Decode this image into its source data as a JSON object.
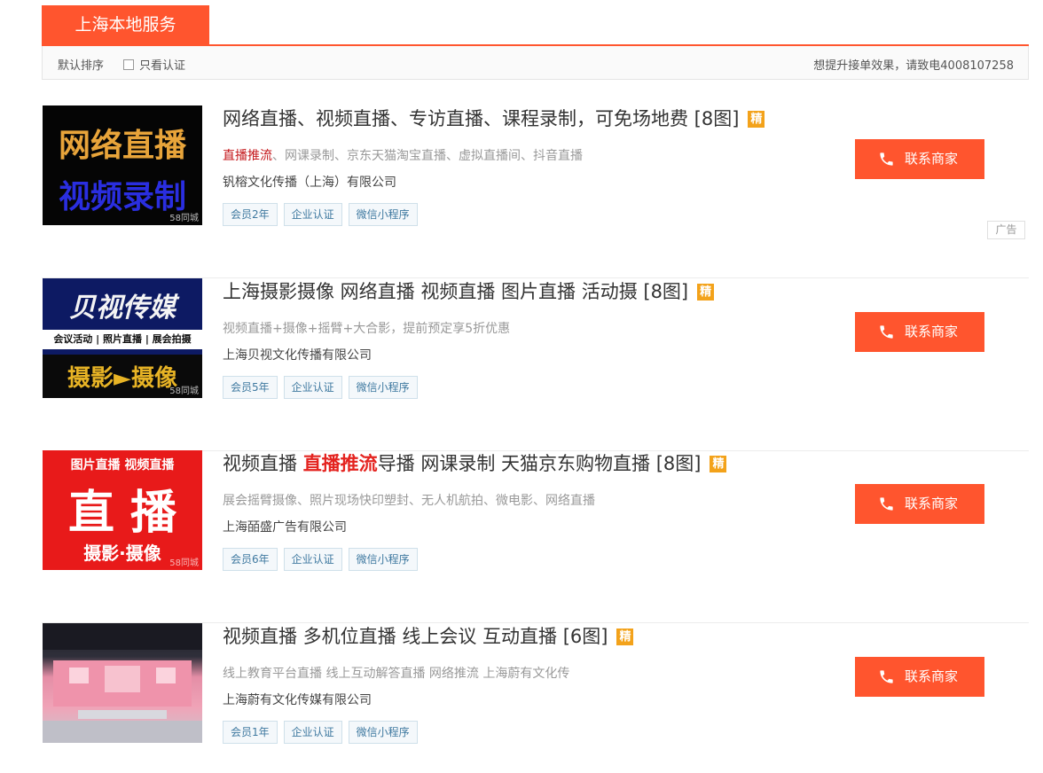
{
  "tab": {
    "label": "上海本地服务"
  },
  "filter": {
    "sort_default": "默认排序",
    "verified_only": "只看认证",
    "upgrade_tip": "想提升接单效果，请致电4008107258"
  },
  "ad_label": "广告",
  "contact_label": "联系商家",
  "jing_label": "精",
  "colors": {
    "accent": "#ff552e",
    "badge_text": "#3f79a0",
    "jing": "#f3a21a",
    "highlight": "#e4231f"
  },
  "listings": [
    {
      "title": "网络直播、视频直播、专访直播、课程录制，可免场地费 [8图]",
      "desc_highlight": "直播推流",
      "desc_rest": "、网课录制、京东天猫淘宝直播、虚拟直播间、抖音直播",
      "company": "钒榕文化传播（上海）有限公司",
      "badges": [
        "会员2年",
        "企业认证",
        "微信小程序"
      ],
      "thumb": {
        "line1": "网络直播",
        "line2": "视频录制",
        "watermark": "58同城"
      }
    },
    {
      "title": "上海摄影摄像 网络直播 视频直播 图片直播 活动摄 [8图]",
      "desc": "视频直播+摄像+摇臂+大合影，提前预定享5折优惠",
      "company": "上海贝视文化传播有限公司",
      "badges": [
        "会员5年",
        "企业认证",
        "微信小程序"
      ],
      "thumb": {
        "line1": "贝视传媒",
        "line2": "会议活动 | 照片直播 | 展会拍摄",
        "line3": "摄影►摄像",
        "watermark": "58同城"
      }
    },
    {
      "title_pre": "视频直播 ",
      "title_hl": "直播推流",
      "title_post": "导播 网课录制 天猫京东购物直播 [8图]",
      "desc": "展会摇臂摄像、照片现场快印塑封、无人机航拍、微电影、网络直播",
      "company": "上海皕盛广告有限公司",
      "badges": [
        "会员6年",
        "企业认证",
        "微信小程序"
      ],
      "thumb": {
        "line1": "图片直播  视频直播",
        "line2": "直 播",
        "line3": "摄影·摄像",
        "watermark": "58同城"
      }
    },
    {
      "title": "视频直播 多机位直播 线上会议 互动直播 [6图]",
      "desc": "线上教育平台直播 线上互动解答直播 网络推流 上海蔚有文化传",
      "company": "上海蔚有文化传媒有限公司",
      "badges": [
        "会员1年",
        "企业认证",
        "微信小程序"
      ]
    }
  ]
}
